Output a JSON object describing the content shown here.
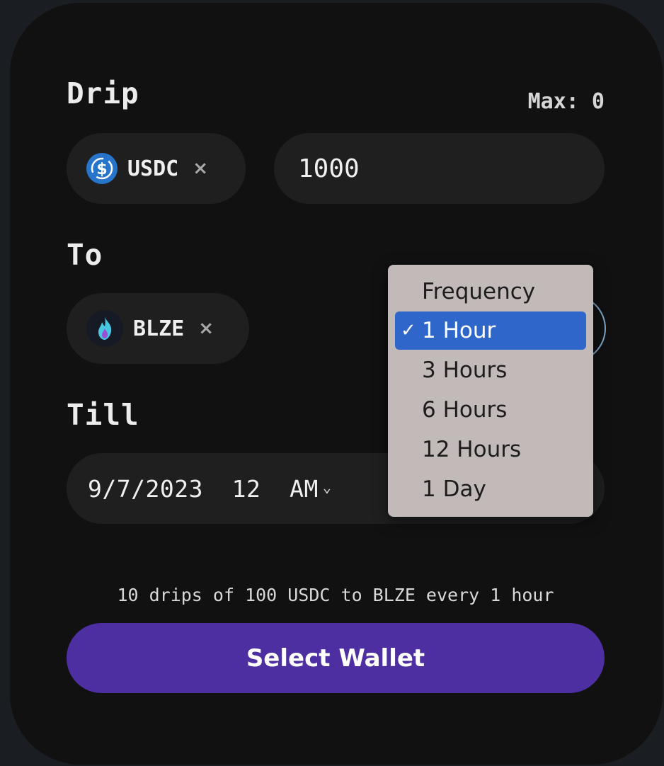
{
  "drip": {
    "label": "Drip",
    "max_text": "Max: 0",
    "token": {
      "symbol": "USDC",
      "remove": "×",
      "icon": "usdc-icon",
      "color": "#2775ca"
    },
    "amount": "1000"
  },
  "to": {
    "label": "To",
    "token": {
      "symbol": "BLZE",
      "remove": "×",
      "icon": "flame-icon"
    }
  },
  "till": {
    "label": "Till",
    "date": "9/7/2023  12  AM",
    "chevron": "⌄"
  },
  "frequency_menu": {
    "title": "Frequency",
    "selected_check": "✓",
    "options": [
      "1 Hour",
      "3 Hours",
      "6 Hours",
      "12 Hours",
      "1 Day"
    ],
    "selected_index": 0
  },
  "summary": "10 drips of 100 USDC to BLZE every 1 hour",
  "button": {
    "label": "Select Wallet",
    "color": "#4d2fa1"
  }
}
